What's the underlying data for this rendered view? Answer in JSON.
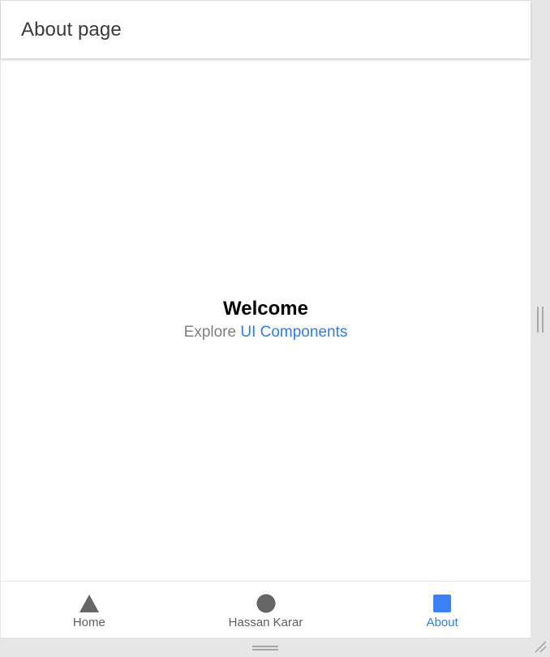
{
  "header": {
    "title": "About page"
  },
  "main": {
    "heading": "Welcome",
    "explore_prefix": "Explore",
    "explore_link": "UI Components"
  },
  "tabbar": {
    "tabs": [
      {
        "label": "Home",
        "icon": "triangle-icon",
        "active": false
      },
      {
        "label": "Hassan Karar",
        "icon": "circle-icon",
        "active": false
      },
      {
        "label": "About",
        "icon": "square-icon",
        "active": true
      }
    ]
  },
  "colors": {
    "accent": "#2f7de1",
    "icon_inactive": "#666666",
    "icon_active": "#3b82f6",
    "text_muted": "#808080"
  }
}
